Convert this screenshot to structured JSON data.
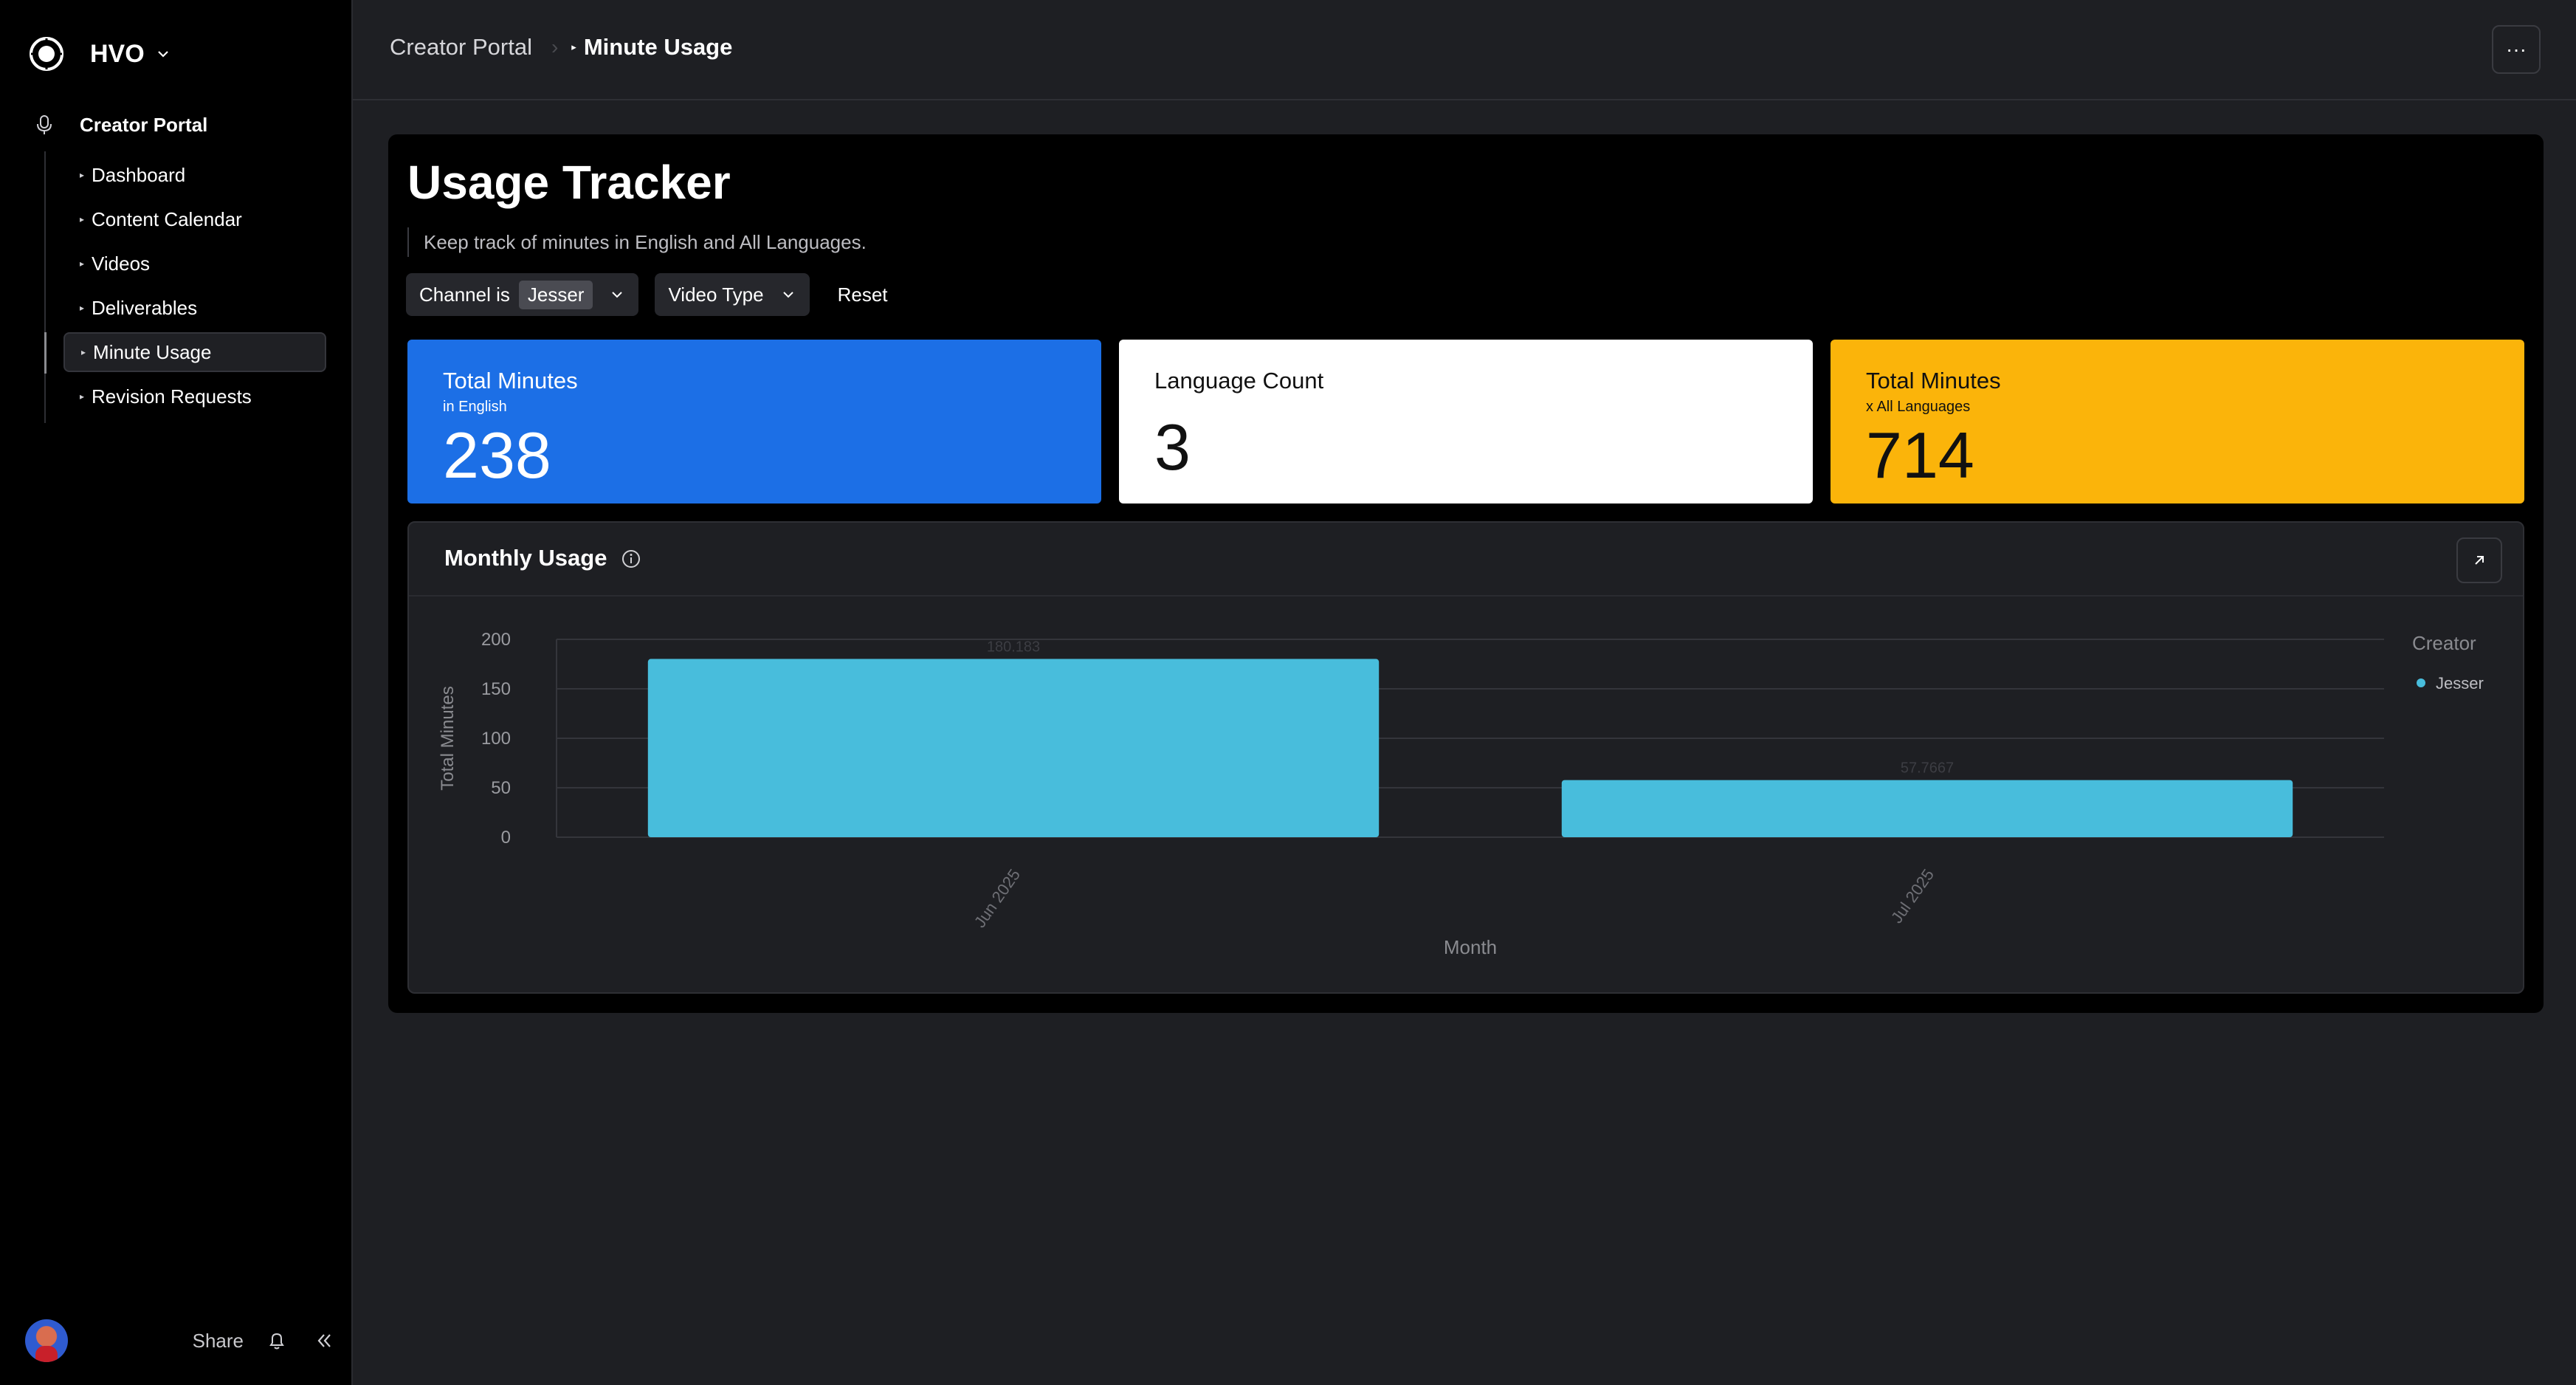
{
  "app": {
    "workspace": "HVO"
  },
  "sidebar": {
    "section": "Creator Portal",
    "items": [
      {
        "label": "Dashboard"
      },
      {
        "label": "Content Calendar"
      },
      {
        "label": "Videos"
      },
      {
        "label": "Deliverables"
      },
      {
        "label": "Minute Usage",
        "active": true
      },
      {
        "label": "Revision Requests"
      }
    ],
    "footer": {
      "share": "Share"
    }
  },
  "topbar": {
    "breadcrumb_root": "Creator Portal",
    "breadcrumb_current": "Minute Usage",
    "more_label": "···"
  },
  "main": {
    "title": "Usage Tracker",
    "description": "Keep track of minutes in English and All Languages.",
    "filters": {
      "channel_prefix": "Channel is",
      "channel_value": "Jesser",
      "video_type": "Video Type",
      "reset": "Reset"
    },
    "cards": [
      {
        "title": "Total Minutes",
        "subtitle": "in English",
        "value": "238",
        "color": "#1c6fe6"
      },
      {
        "title": "Language Count",
        "value": "3",
        "color": "#ffffff"
      },
      {
        "title": "Total Minutes",
        "subtitle": "x All Languages",
        "value": "714",
        "color": "#fbb40a"
      }
    ],
    "chart_title": "Monthly Usage"
  },
  "chart_data": {
    "type": "bar",
    "categories": [
      "Jun 2025",
      "Jul 2025"
    ],
    "series": [
      {
        "name": "Jesser",
        "values": [
          180.183,
          57.7667
        ],
        "color": "#48bddc"
      }
    ],
    "data_labels": [
      "180.183",
      "57.7667"
    ],
    "xlabel": "Month",
    "ylabel": "Total Minutes",
    "ylim": [
      0,
      200
    ],
    "yticks": [
      0,
      50,
      100,
      150,
      200
    ],
    "legend_title": "Creator",
    "legend_position": "top-right",
    "grid": true
  }
}
